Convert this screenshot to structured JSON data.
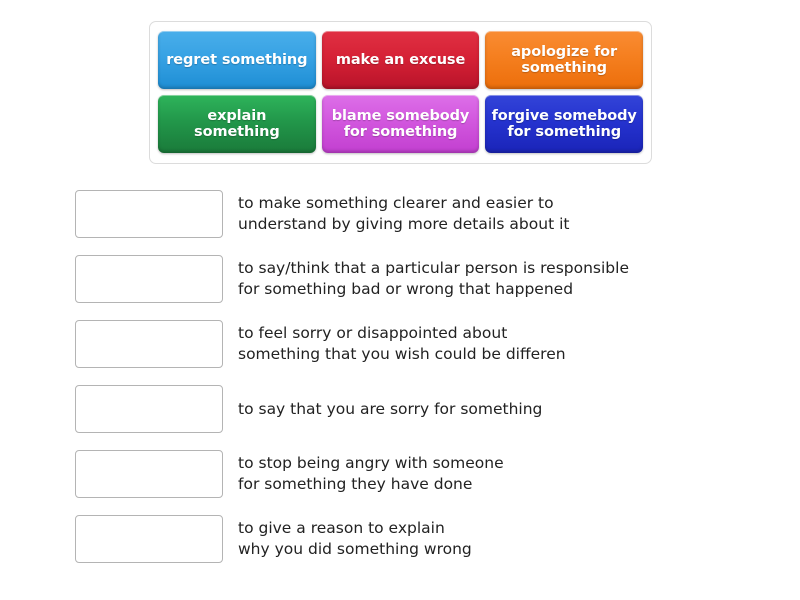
{
  "activity": {
    "type": "match-up",
    "tray": {
      "tiles": [
        {
          "label": "regret something",
          "color": "#1e8ed4",
          "color_name": "blue"
        },
        {
          "label": "make an excuse",
          "color": "#d62236",
          "color_name": "red"
        },
        {
          "label": "apologize for\nsomething",
          "color": "#f57f1f",
          "color_name": "orange"
        },
        {
          "label": "explain\nsomething",
          "color": "#22974a",
          "color_name": "green"
        },
        {
          "label": "blame somebody\nfor something",
          "color": "#d257de",
          "color_name": "orchid"
        },
        {
          "label": "forgive somebody\nfor something",
          "color": "#2533cf",
          "color_name": "navy"
        }
      ]
    },
    "definitions": [
      {
        "drop_value": "",
        "text": "to make something clearer and easier to\nunderstand by giving more details about it"
      },
      {
        "drop_value": "",
        "text": "to say/think that a particular person is responsible\nfor something bad or wrong that happened"
      },
      {
        "drop_value": "",
        "text": "to feel sorry or disappointed about\nsomething that you wish could be differen"
      },
      {
        "drop_value": "",
        "text": "to say that you are sorry for something"
      },
      {
        "drop_value": "",
        "text": "to stop being angry with someone\nfor something they have done"
      },
      {
        "drop_value": "",
        "text": "to give a reason to explain\nwhy you did something wrong"
      }
    ]
  }
}
